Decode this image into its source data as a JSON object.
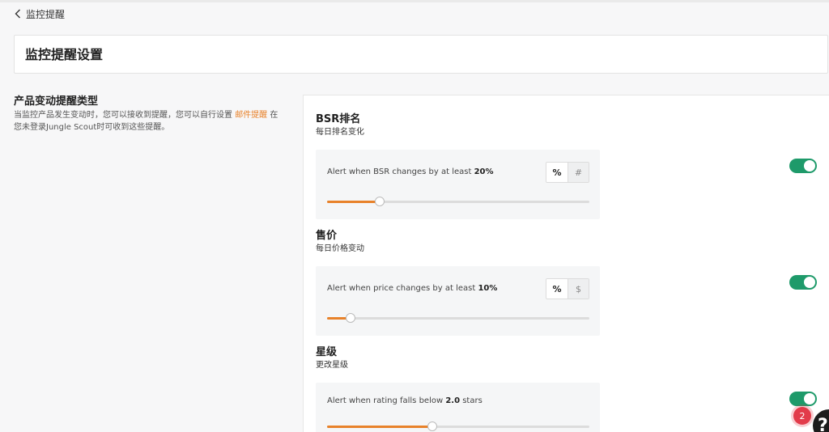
{
  "nav": {
    "back_label": "监控提醒"
  },
  "header": {
    "title": "监控提醒设置"
  },
  "description": {
    "title": "产品变动提醒类型",
    "text_before": "当监控产品发生变动时，您可以接收到提醒，您可以自行设置 ",
    "link": "邮件提醒",
    "text_after": " 在您未登录Jungle Scout时可收到这些提醒。"
  },
  "sections": [
    {
      "title": "BSR排名",
      "subtitle": "每日排名变化",
      "alert_prefix": "Alert when BSR changes by at least ",
      "alert_value": "20%",
      "alert_suffix": "",
      "units": [
        "%",
        "#"
      ],
      "selected_unit": "%",
      "slider_fraction": 0.2,
      "enabled": true
    },
    {
      "title": "售价",
      "subtitle": "每日价格变动",
      "alert_prefix": "Alert when price changes by at least ",
      "alert_value": "10%",
      "alert_suffix": "",
      "units": [
        "%",
        "$"
      ],
      "selected_unit": "%",
      "slider_fraction": 0.09,
      "enabled": true
    },
    {
      "title": "星级",
      "subtitle": "更改星级",
      "alert_prefix": "Alert when rating falls below ",
      "alert_value": "2.0",
      "alert_suffix": " stars",
      "units": [],
      "slider_fraction": 0.4,
      "enabled": true
    }
  ],
  "widgets": {
    "notification_count": "2",
    "help_label": "?"
  },
  "colors": {
    "accent": "#e8822a",
    "toggle_on": "#1e9a6a",
    "badge": "#e23b4a"
  },
  "icons": {
    "back": "chevron-left-icon",
    "help": "help-icon"
  }
}
